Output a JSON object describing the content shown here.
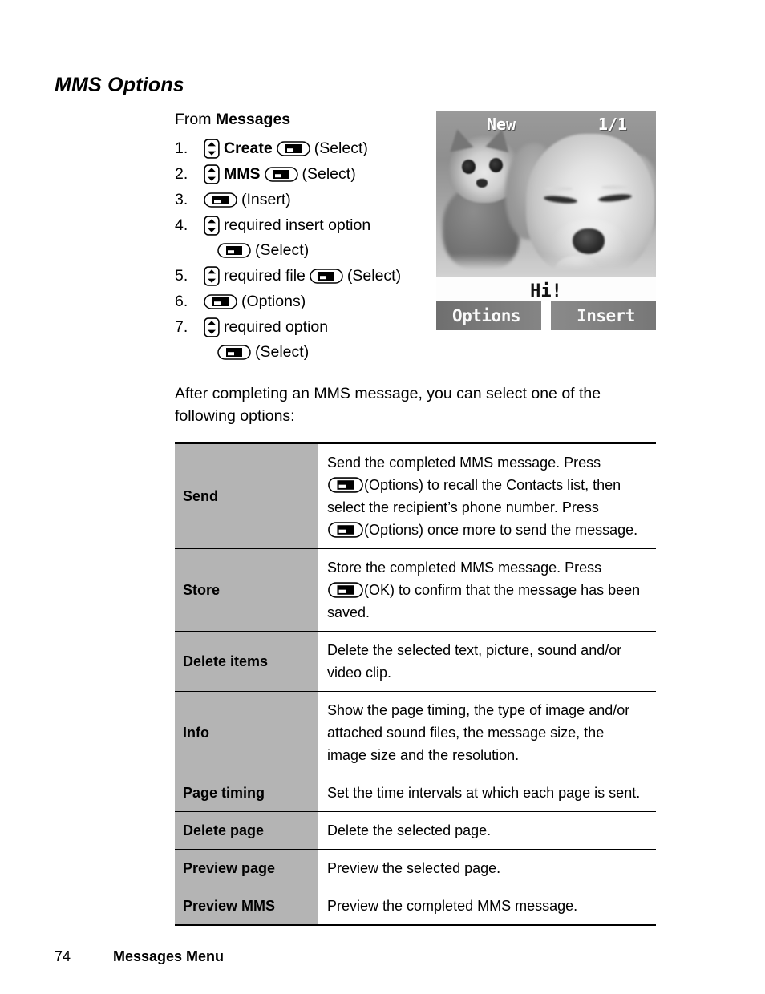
{
  "page": {
    "heading": "MMS Options",
    "footer_page_number": "74",
    "footer_section": "Messages Menu"
  },
  "procedure": {
    "from_prefix": "From ",
    "from_target": "Messages",
    "steps": [
      {
        "number": "1.",
        "lines": [
          {
            "indent": false,
            "parts": [
              {
                "type": "icon",
                "icon": "scroll-icon"
              },
              {
                "type": "text",
                "text": "Create",
                "bold": true
              },
              {
                "type": "icon",
                "icon": "softkey-icon"
              },
              {
                "type": "text",
                "text": "(Select)",
                "bold": false
              }
            ]
          }
        ]
      },
      {
        "number": "2.",
        "lines": [
          {
            "indent": false,
            "parts": [
              {
                "type": "icon",
                "icon": "scroll-icon"
              },
              {
                "type": "text",
                "text": "MMS",
                "bold": true
              },
              {
                "type": "icon",
                "icon": "softkey-icon"
              },
              {
                "type": "text",
                "text": "(Select)",
                "bold": false
              }
            ]
          }
        ]
      },
      {
        "number": "3.",
        "lines": [
          {
            "indent": false,
            "parts": [
              {
                "type": "icon",
                "icon": "softkey-icon"
              },
              {
                "type": "text",
                "text": "(Insert)",
                "bold": false
              }
            ]
          }
        ]
      },
      {
        "number": "4.",
        "lines": [
          {
            "indent": false,
            "parts": [
              {
                "type": "icon",
                "icon": "scroll-icon"
              },
              {
                "type": "text",
                "text": "required insert option",
                "bold": false
              }
            ]
          },
          {
            "indent": true,
            "parts": [
              {
                "type": "icon",
                "icon": "softkey-icon"
              },
              {
                "type": "text",
                "text": "(Select)",
                "bold": false
              }
            ]
          }
        ]
      },
      {
        "number": "5.",
        "lines": [
          {
            "indent": false,
            "parts": [
              {
                "type": "icon",
                "icon": "scroll-icon"
              },
              {
                "type": "text",
                "text": "required file",
                "bold": false
              },
              {
                "type": "icon",
                "icon": "softkey-icon"
              },
              {
                "type": "text",
                "text": "(Select)",
                "bold": false
              }
            ]
          }
        ]
      },
      {
        "number": "6.",
        "lines": [
          {
            "indent": false,
            "parts": [
              {
                "type": "icon",
                "icon": "softkey-icon"
              },
              {
                "type": "text",
                "text": "(Options)",
                "bold": false
              }
            ]
          }
        ]
      },
      {
        "number": "7.",
        "lines": [
          {
            "indent": false,
            "parts": [
              {
                "type": "icon",
                "icon": "scroll-icon"
              },
              {
                "type": "text",
                "text": "required option",
                "bold": false
              }
            ]
          },
          {
            "indent": true,
            "parts": [
              {
                "type": "icon",
                "icon": "softkey-icon"
              },
              {
                "type": "text",
                "text": "(Select)",
                "bold": false
              }
            ]
          }
        ]
      }
    ]
  },
  "phone_screen": {
    "status_left": "New",
    "status_right": "1/1",
    "caption_text": "Hi!",
    "softkey_left": "Options",
    "softkey_right": "Insert",
    "photo_description": "kitten and sleeping puppy photograph"
  },
  "intro_paragraph": "After completing an MMS message, you can select one of the following options:",
  "options_table": {
    "rows": [
      {
        "key": "Send",
        "lines": [
          {
            "parts": [
              {
                "type": "text",
                "text": "Send the completed MMS message. Press"
              }
            ]
          },
          {
            "parts": [
              {
                "type": "icon",
                "icon": "softkey-icon"
              },
              {
                "type": "text",
                "text": "(Options) to recall the Contacts list, then"
              }
            ]
          },
          {
            "parts": [
              {
                "type": "text",
                "text": "select the recipient’s phone number. Press"
              }
            ]
          },
          {
            "parts": [
              {
                "type": "icon",
                "icon": "softkey-icon"
              },
              {
                "type": "text",
                "text": "(Options) once more to send the message."
              }
            ]
          }
        ]
      },
      {
        "key": "Store",
        "lines": [
          {
            "parts": [
              {
                "type": "text",
                "text": "Store the completed MMS message. Press"
              }
            ]
          },
          {
            "parts": [
              {
                "type": "icon",
                "icon": "softkey-icon"
              },
              {
                "type": "text",
                "text": "(OK)  to confirm that the message has been"
              }
            ]
          },
          {
            "parts": [
              {
                "type": "text",
                "text": "saved."
              }
            ]
          }
        ]
      },
      {
        "key": "Delete items",
        "lines": [
          {
            "parts": [
              {
                "type": "text",
                "text": "Delete the selected text, picture, sound and/or"
              }
            ]
          },
          {
            "parts": [
              {
                "type": "text",
                "text": "video clip."
              }
            ]
          }
        ]
      },
      {
        "key": "Info",
        "lines": [
          {
            "parts": [
              {
                "type": "text",
                "text": "Show the page timing, the type of image and/or"
              }
            ]
          },
          {
            "parts": [
              {
                "type": "text",
                "text": "attached sound files, the message size, the"
              }
            ]
          },
          {
            "parts": [
              {
                "type": "text",
                "text": "image size and the resolution."
              }
            ]
          }
        ]
      },
      {
        "key": "Page timing",
        "lines": [
          {
            "parts": [
              {
                "type": "text",
                "text": "Set the time intervals at which each page is sent."
              }
            ]
          }
        ]
      },
      {
        "key": "Delete page",
        "lines": [
          {
            "parts": [
              {
                "type": "text",
                "text": "Delete the selected page."
              }
            ]
          }
        ]
      },
      {
        "key": "Preview page",
        "lines": [
          {
            "parts": [
              {
                "type": "text",
                "text": "Preview the selected page."
              }
            ]
          }
        ]
      },
      {
        "key": "Preview MMS",
        "lines": [
          {
            "parts": [
              {
                "type": "text",
                "text": "Preview the completed MMS message."
              }
            ]
          }
        ]
      }
    ]
  },
  "colors": {
    "table_key_background": "#b4b4b4",
    "table_border": "#000000",
    "page_background": "#ffffff",
    "text": "#000000",
    "phone_softkey_background": "#7b7b7b"
  }
}
